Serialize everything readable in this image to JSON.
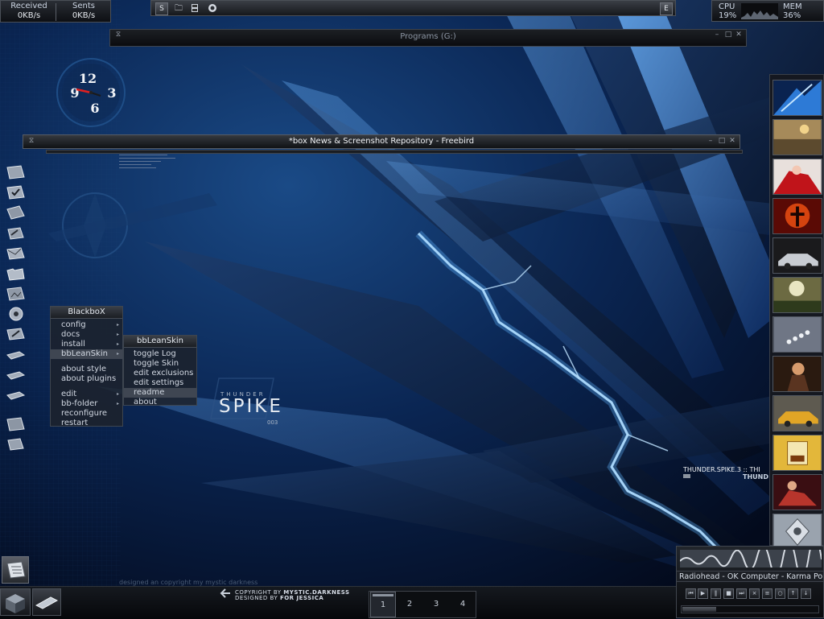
{
  "netmon": {
    "received_label": "Received",
    "received_value": "0KB/s",
    "sent_label": "Sents",
    "sent_value": "0KB/s"
  },
  "toolbar": {
    "left_button": "S",
    "right_button": "E",
    "icons": [
      "folder-icon",
      "film-icon",
      "globe-icon"
    ]
  },
  "sysmon": {
    "cpu_label": "CPU",
    "cpu_value": "19%",
    "mem_label": "MEM",
    "mem_value": "36%"
  },
  "windows": {
    "programs_title": "Programs (G:)",
    "news_title": "*box News & Screenshot Repository - Freebird"
  },
  "clock": {
    "numbers": [
      "12",
      "3",
      "6",
      "9"
    ]
  },
  "menu_main": {
    "title": "BlackboX",
    "items": [
      "config",
      "docs",
      "install",
      "bbLeanSkin",
      "about style",
      "about plugins",
      "edit",
      "bb-folder",
      "reconfigure",
      "restart"
    ]
  },
  "menu_sub": {
    "title": "bbLeanSkin",
    "items": [
      "toggle Log",
      "toggle Skin",
      "edit exclusions",
      "edit settings",
      "readme",
      "about"
    ]
  },
  "logo": {
    "line1": "THUNDER",
    "line2": "SPIKE",
    "line3": "003"
  },
  "ticker": {
    "text1": "THUNDER.SPIKE.3 :: THI",
    "text2": "THUND"
  },
  "player": {
    "track": "Radiohead - OK Computer - Karma Police",
    "controls": [
      "prev",
      "play",
      "pause",
      "stop",
      "next",
      "shuffle",
      "playlist",
      "options",
      "volume-up",
      "volume-down"
    ]
  },
  "bottom": {
    "designed_line": "designed an copyright my mystic darkness",
    "credit_line1_prefix": "COPYRIGHT BY",
    "credit_line1_name": "MYSTIC.DARKNESS",
    "credit_line2_prefix": "DESIGNED BY",
    "credit_line2_name": "FOR JESSICA",
    "workspaces": [
      "1",
      "2",
      "3",
      "4"
    ],
    "active_workspace": "1"
  },
  "colors": {
    "background": "#041026",
    "accent_blue": "#3a8cff",
    "panel": "#1c1f24"
  }
}
